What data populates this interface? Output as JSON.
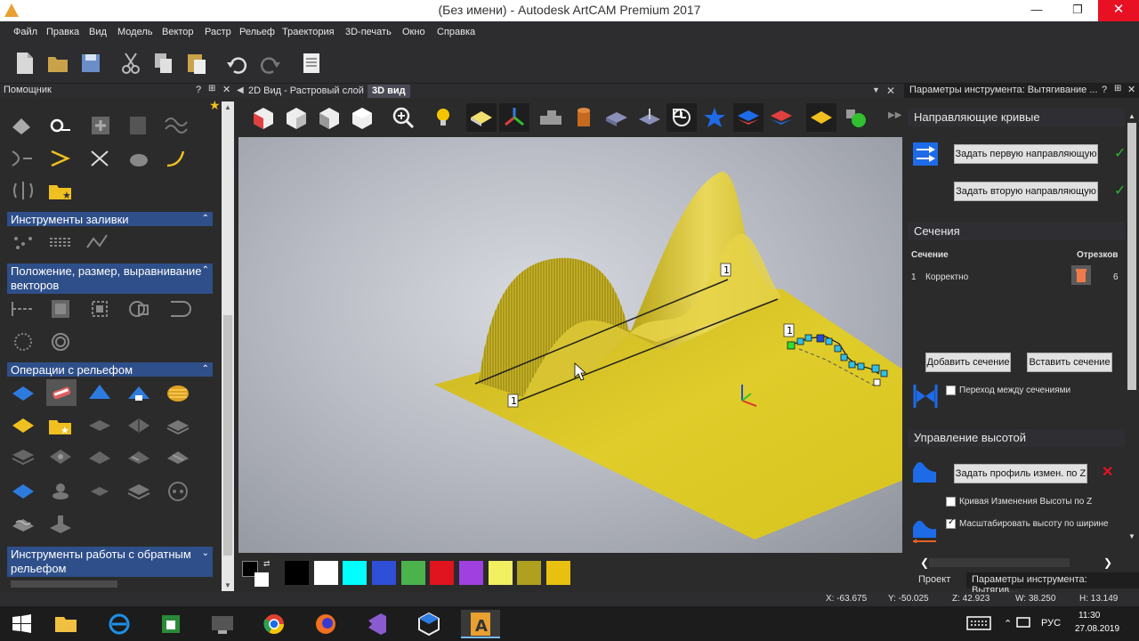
{
  "window": {
    "title": "(Без имени) - Autodesk ArtCAM Premium 2017",
    "minimize": "—",
    "maximize": "❐",
    "close": "✕"
  },
  "menu": [
    "Файл",
    "Правка",
    "Вид",
    "Модель",
    "Вектор",
    "Растр",
    "Рельеф",
    "Траектория",
    "3D-печать",
    "Окно",
    "Справка"
  ],
  "left_panel": {
    "title": "Помощник",
    "pin": "?",
    "sections": [
      {
        "title": "Инструменты заливки"
      },
      {
        "title": "Положение, размер, выравнивание векторов"
      },
      {
        "title": "Операции с рельефом"
      },
      {
        "title": "Инструменты работы с обратным рельефом"
      }
    ]
  },
  "center": {
    "tabs": [
      {
        "label": "2D Вид - Растровый слой"
      },
      {
        "label": "3D вид"
      }
    ],
    "viewport_labels": [
      "1",
      "1",
      "1"
    ]
  },
  "palette": {
    "colors": [
      "#000000",
      "#ffffff",
      "#00ffff",
      "#2e4fd6",
      "#4cb34c",
      "#e0141e",
      "#a040e0",
      "#f0f060",
      "#b0a020",
      "#e8c010"
    ]
  },
  "right_panel": {
    "title": "Параметры инструмента: Вытягивание ...",
    "guide_curves": {
      "title": "Направляющие кривые",
      "first_button": "Задать первую направляющую",
      "second_button": "Задать вторую направляющую"
    },
    "sections": {
      "title": "Сечения",
      "col_section": "Сечение",
      "col_segments": "Отрезков",
      "rows": [
        {
          "num": "1",
          "status": "Корректно",
          "segments": "6"
        }
      ],
      "add_button": "Добавить сечение",
      "insert_button": "Вставить сечение",
      "transition_label": "Переход между сечениями",
      "transition_checked": false
    },
    "height": {
      "title": "Управление высотой",
      "profile_button": "Задать профиль измен. по Z",
      "curve_label": "Кривая Изменения Высоты по Z",
      "curve_checked": false,
      "scale_label": "Масштабировать высоту по ширине",
      "scale_checked": true
    },
    "bottom_tabs": [
      {
        "label": "Проект"
      },
      {
        "label": "Параметры инструмента: Вытягив..."
      }
    ]
  },
  "status": {
    "x": "X: -63.675",
    "y": "Y: -50.025",
    "z": "Z: 42.923",
    "w": "W: 38.250",
    "h": "H: 13.149"
  },
  "taskbar": {
    "lang": "РУС",
    "time": "11:30",
    "date": "27.08.2019"
  },
  "accent_colors": {
    "section_header": "#2e4f8a",
    "relief": "#d8c41a",
    "check": "#2fb52f"
  }
}
